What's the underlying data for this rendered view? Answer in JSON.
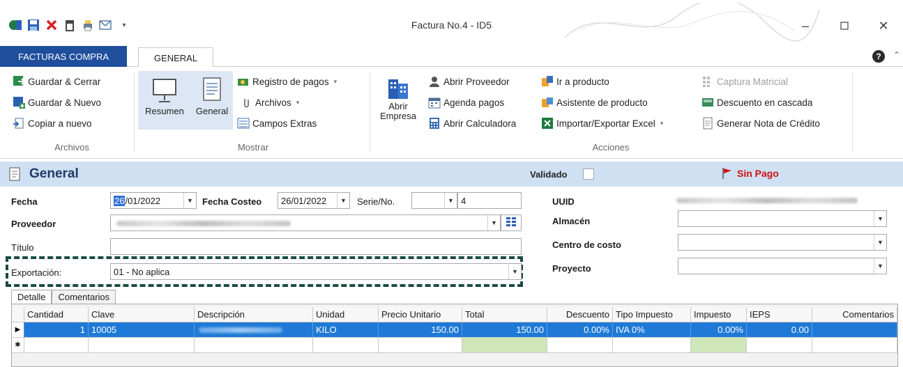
{
  "window": {
    "title": "Factura No.4 - ID5"
  },
  "tabs": {
    "file": "FACTURAS COMPRA",
    "general": "GENERAL"
  },
  "ribbon": {
    "archivos": {
      "label": "Archivos",
      "guardar_cerrar": "Guardar & Cerrar",
      "guardar_nuevo": "Guardar & Nuevo",
      "copiar_nuevo": "Copiar a nuevo"
    },
    "mostrar": {
      "label": "Mostrar",
      "resumen": "Resumen",
      "general": "General",
      "registro_pagos": "Registro de pagos",
      "archivos": "Archivos",
      "campos_extras": "Campos Extras"
    },
    "acciones": {
      "label": "Acciones",
      "abrir": "Abrir",
      "empresa": "Empresa",
      "abrir_proveedor": "Abrir Proveedor",
      "agenda_pagos": "Agenda pagos",
      "abrir_calculadora": "Abrir Calculadora",
      "ir_producto": "Ir a producto",
      "asistente_producto": "Asistente de producto",
      "importar_excel": "Importar/Exportar Excel",
      "captura_matricial": "Captura Matricial",
      "descuento_cascada": "Descuento en cascada",
      "nota_credito": "Generar Nota de Crédito"
    }
  },
  "header": {
    "title": "General",
    "validado": "Validado",
    "status": "Sin Pago"
  },
  "form": {
    "fecha_label": "Fecha",
    "fecha_sel": "26",
    "fecha_rest": "/01/2022",
    "fecha_costeo_label": "Fecha Costeo",
    "fecha_costeo_value": "26/01/2022",
    "serie_label": "Serie/No.",
    "serie_no": "4",
    "proveedor_label": "Proveedor",
    "titulo_label": "Título",
    "exportacion_label": "Exportación:",
    "exportacion_value": "01 - No aplica",
    "uuid_label": "UUID",
    "almacen_label": "Almacén",
    "centro_costo_label": "Centro de costo",
    "proyecto_label": "Proyecto"
  },
  "subtabs": {
    "detalle": "Detalle",
    "comentarios": "Comentarios"
  },
  "grid": {
    "columns": [
      "Cantidad",
      "Clave",
      "Descripción",
      "Unidad",
      "Precio Unitario",
      "Total",
      "Descuento",
      "Tipo Impuesto",
      "Impuesto",
      "IEPS",
      "Comentarios"
    ],
    "rows": [
      {
        "cantidad": "1",
        "clave": "10005",
        "unidad": "KILO",
        "precio": "150.00",
        "total": "150.00",
        "descuento": "0.00%",
        "tipo_impuesto": "IVA 0%",
        "impuesto": "0.00%",
        "ieps": "0.00",
        "comentarios": ""
      }
    ],
    "new_row_marker": "✱",
    "current_row_marker": "▶"
  },
  "colors": {
    "accent": "#1f4e9c",
    "band": "#cfe0f3",
    "selection": "#1e7ad6",
    "danger": "#d01010"
  }
}
